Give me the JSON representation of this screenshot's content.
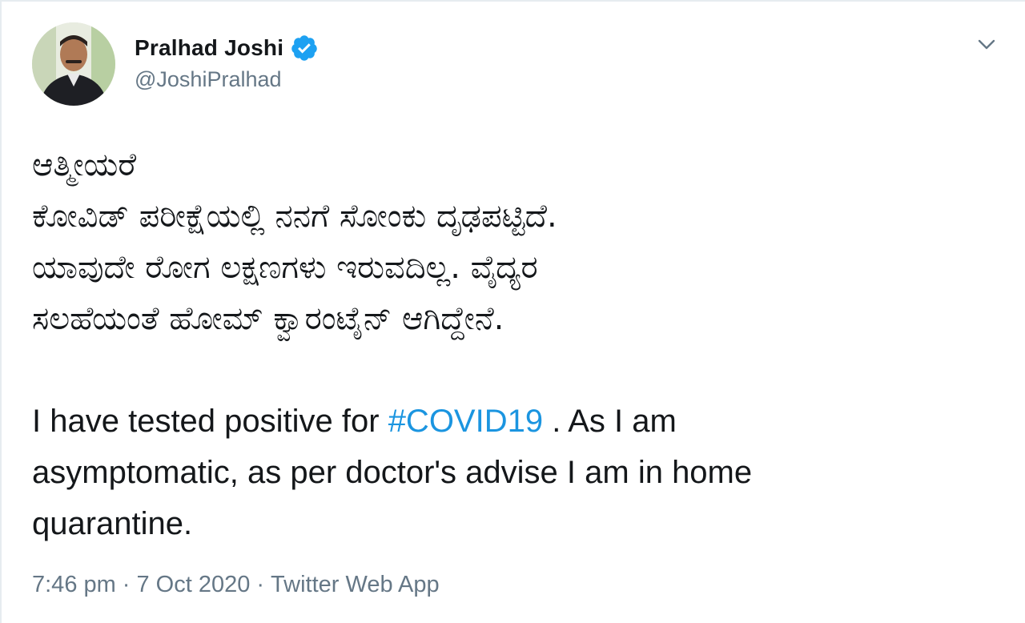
{
  "tweet": {
    "author": {
      "display_name": "Pralhad Joshi",
      "handle": "@JoshiPralhad",
      "verified": true
    },
    "icons": {
      "verified": "verified-badge-icon",
      "caret": "chevron-down-icon"
    },
    "text_kannada": [
      "ಆತ್ಮೀಯರೆ",
      "ಕೋವಿಡ್ ಪರೀಕ್ಷೆಯಲ್ಲಿ ನನಗೆ ಸೋಂಕು ದೃಢಪಟ್ಟಿದೆ.",
      "ಯಾವುದೇ ರೋಗ ಲಕ್ಷಣಗಳು ಇರುವದಿಲ್ಲ. ವೈದ್ಯರ",
      "ಸಲಹೆಯಂತೆ ಹೋಮ್ ಕ್ವಾರಂಟೈನ್ ಆಗಿದ್ದೇನೆ."
    ],
    "text_english": {
      "before_hashtag": "I have tested positive for ",
      "hashtag": "#COVID19",
      "after_hashtag": " . As I am",
      "line2": "asymptomatic, as per doctor's advise I am in home",
      "line3": "quarantine."
    },
    "meta": {
      "time": "7:46 pm",
      "separator": "·",
      "date": "7 Oct 2020",
      "source": "Twitter Web App"
    },
    "colors": {
      "link": "#1b95e0",
      "verified": "#1da1f2",
      "secondary_text": "#657786"
    }
  }
}
